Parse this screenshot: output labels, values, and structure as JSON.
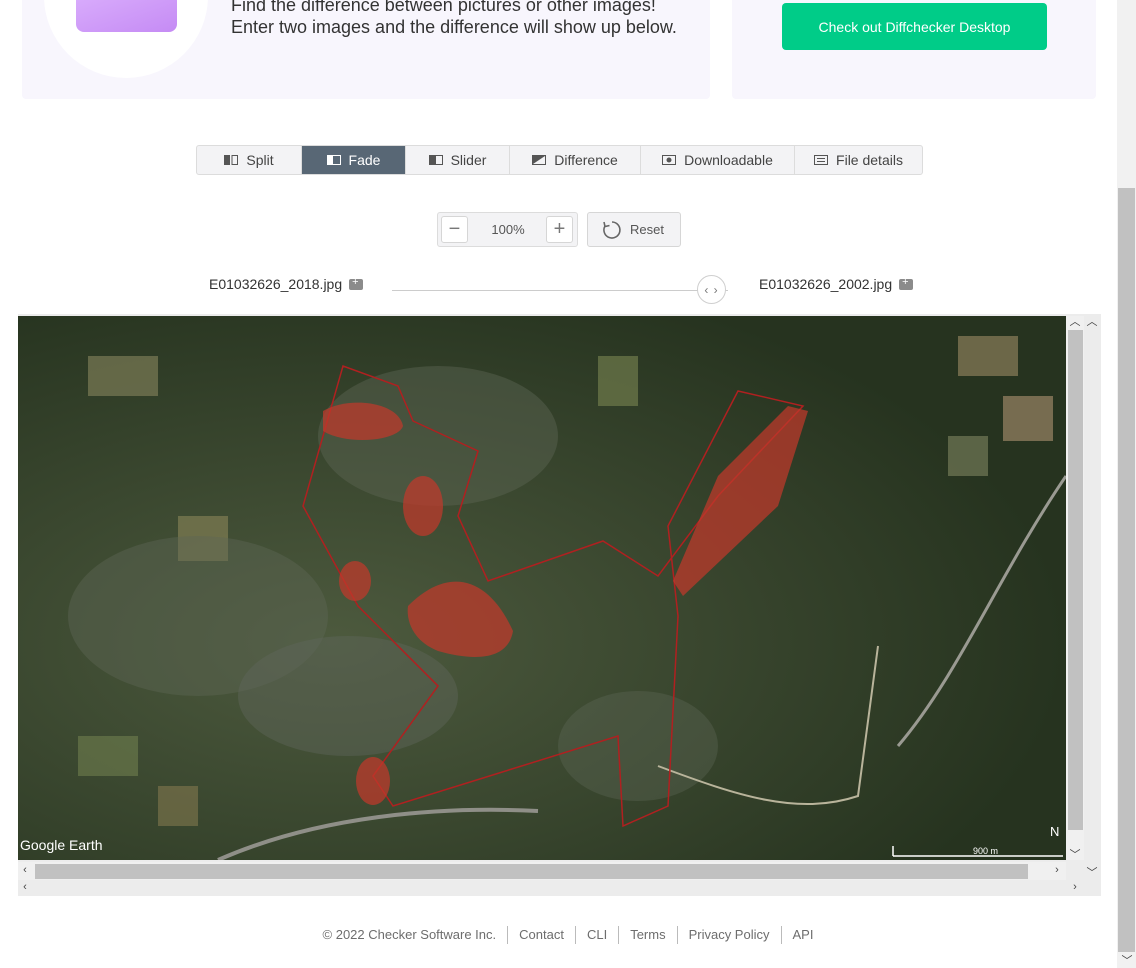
{
  "promo": {
    "line1": "Find the difference between pictures or other images!",
    "line2": "Enter two images and the difference will show up below.",
    "desktop_button": "Check out Diffchecker Desktop"
  },
  "tabs": [
    {
      "label": "Split",
      "icon": "split-icon",
      "active": false
    },
    {
      "label": "Fade",
      "icon": "fade-icon",
      "active": true
    },
    {
      "label": "Slider",
      "icon": "slider-icon",
      "active": false
    },
    {
      "label": "Difference",
      "icon": "difference-icon",
      "active": false
    },
    {
      "label": "Downloadable",
      "icon": "downloadable-icon",
      "active": false
    },
    {
      "label": "File details",
      "icon": "file-details-icon",
      "active": false
    }
  ],
  "zoom": {
    "minus": "−",
    "value": "100%",
    "plus": "+",
    "reset_label": "Reset"
  },
  "files": {
    "left": "E01032626_2018.jpg",
    "right": "E01032626_2002.jpg"
  },
  "image": {
    "watermark": "Google Earth",
    "scale_label": "900 m",
    "north_label": "N"
  },
  "footer": {
    "copyright": "© 2022 Checker Software Inc.",
    "links": [
      "Contact",
      "CLI",
      "Terms",
      "Privacy Policy",
      "API"
    ]
  },
  "colors": {
    "accent": "#00cc88",
    "active_tab": "#586775",
    "highlight": "#c0392b"
  }
}
